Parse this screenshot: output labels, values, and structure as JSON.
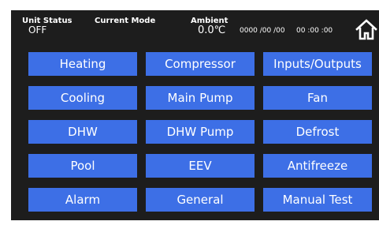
{
  "status": {
    "unit_status_label": "Unit Status",
    "unit_status_value": "OFF",
    "current_mode_label": "Current Mode",
    "current_mode_value": "",
    "ambient_label": "Ambient",
    "ambient_value": "0.0℃",
    "date": "0000 /00 /00",
    "time": "00 :00 :00"
  },
  "home_icon": "home-icon",
  "menu": [
    [
      "Heating",
      "Compressor",
      "Inputs/Outputs"
    ],
    [
      "Cooling",
      "Main Pump",
      "Fan"
    ],
    [
      "DHW",
      "DHW Pump",
      "Defrost"
    ],
    [
      "Pool",
      "EEV",
      "Antifreeze"
    ],
    [
      "Alarm",
      "General",
      "Manual Test"
    ]
  ],
  "colors": {
    "panel_bg": "#1d1d1d",
    "button_bg": "#3d6fe6",
    "text": "#ffffff"
  }
}
